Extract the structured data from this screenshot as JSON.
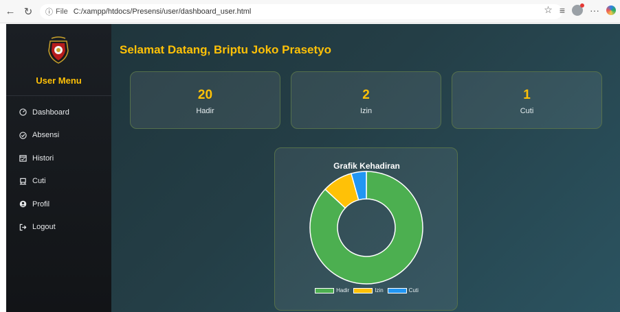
{
  "browser": {
    "scheme": "File",
    "url": "C:/xampp/htdocs/Presensi/user/dashboard_user.html"
  },
  "sidebar": {
    "title": "User Menu",
    "items": [
      {
        "label": "Dashboard",
        "icon": "dashboard-icon"
      },
      {
        "label": "Absensi",
        "icon": "check-circle-icon"
      },
      {
        "label": "Histori",
        "icon": "calendar-icon"
      },
      {
        "label": "Cuti",
        "icon": "bed-icon"
      },
      {
        "label": "Profil",
        "icon": "user-circle-icon"
      },
      {
        "label": "Logout",
        "icon": "logout-icon"
      }
    ]
  },
  "main": {
    "welcome": "Selamat Datang, Briptu Joko Prasetyo",
    "cards": [
      {
        "value": "20",
        "label": "Hadir"
      },
      {
        "value": "2",
        "label": "Izin"
      },
      {
        "value": "1",
        "label": "Cuti"
      }
    ]
  },
  "colors": {
    "accent": "#ffc107",
    "hadir": "#4caf50",
    "izin": "#ffc107",
    "cuti": "#2196f3"
  },
  "chart_data": {
    "type": "pie",
    "title": "Grafik Kehadiran",
    "categories": [
      "Hadir",
      "Izin",
      "Cuti"
    ],
    "values": [
      20,
      2,
      1
    ],
    "legend": "bottom"
  }
}
